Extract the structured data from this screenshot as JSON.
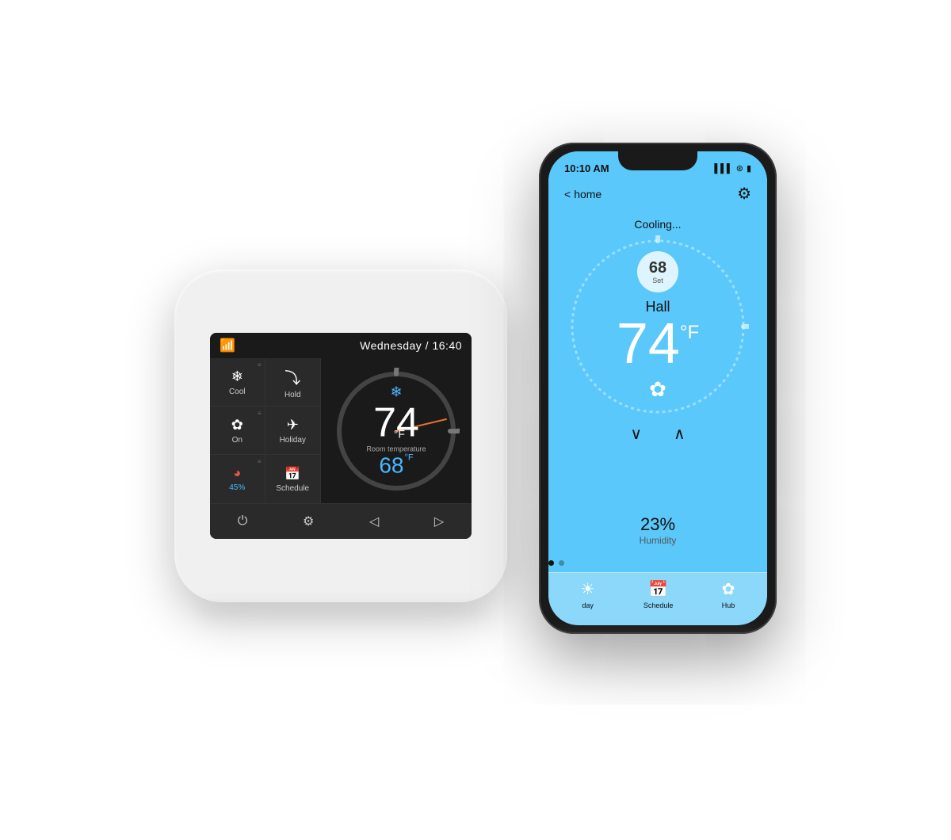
{
  "thermostat": {
    "datetime": "Wednesday / 16:40",
    "buttons": [
      {
        "label": "Cool",
        "icon": "❄",
        "hasMenu": true
      },
      {
        "label": "Hold",
        "icon": "⤵",
        "hasMenu": false
      },
      {
        "label": "On",
        "icon": "✿",
        "hasMenu": true
      },
      {
        "label": "Holiday",
        "icon": "✈",
        "hasMenu": false
      },
      {
        "label": "45%",
        "icon": "◕",
        "hasMenu": true
      },
      {
        "label": "Schedule",
        "icon": "📅",
        "hasMenu": false
      }
    ],
    "room_temp": "74",
    "set_temp": "68",
    "unit": "°F",
    "room_label": "Room temperature",
    "bottom_buttons": [
      "⏻",
      "⚙",
      "◁",
      "▷"
    ]
  },
  "phone": {
    "status_time": "10:10 AM",
    "status_signal": "▌▌▌",
    "status_wifi": "▾",
    "status_battery": "▮▮▮",
    "back_label": "home",
    "mode_label": "Cooling...",
    "setpoint_temp": "68",
    "setpoint_sub": "Set",
    "room_name": "Hall",
    "current_temp": "74",
    "unit": "°F",
    "humidity_value": "23%",
    "humidity_label": "Humidity",
    "nav_items": [
      {
        "label": "day",
        "icon": "☀"
      },
      {
        "label": "Schedule",
        "icon": "📅"
      },
      {
        "label": "Hub",
        "icon": "✿"
      }
    ]
  }
}
